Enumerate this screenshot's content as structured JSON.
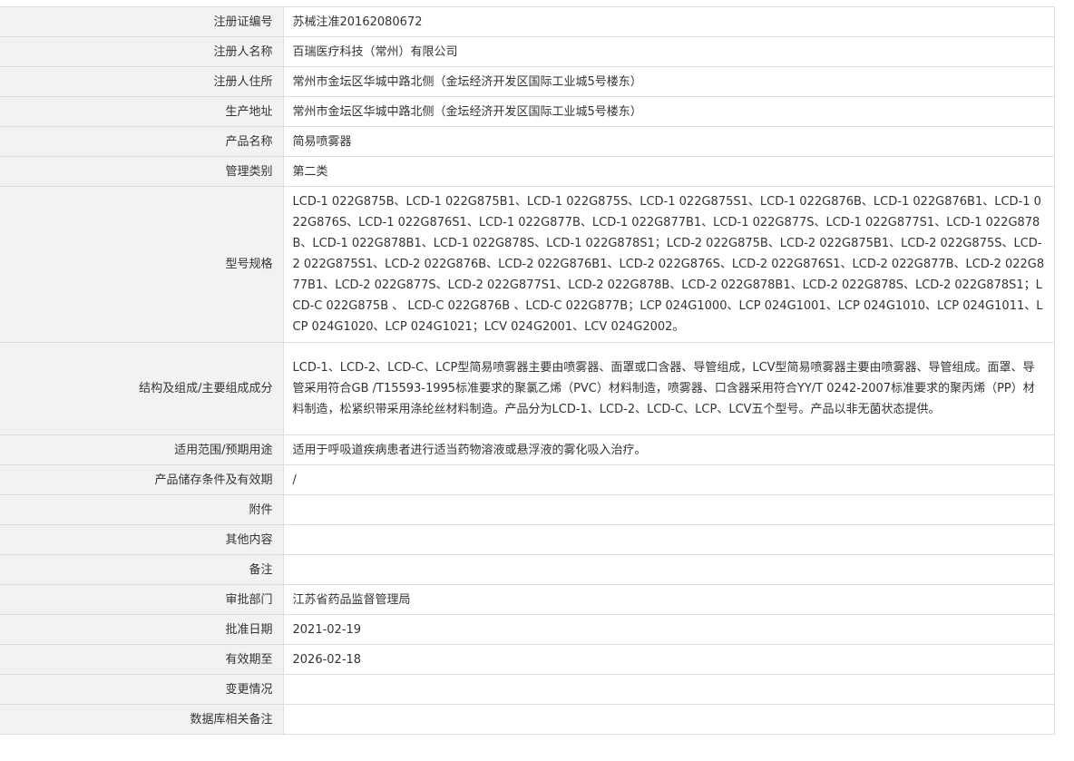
{
  "rows": [
    {
      "label": "注册证编号",
      "value": "苏械注准20162080672"
    },
    {
      "label": "注册人名称",
      "value": "百瑞医疗科技（常州）有限公司"
    },
    {
      "label": "注册人住所",
      "value": "常州市金坛区华城中路北侧（金坛经济开发区国际工业城5号楼东）"
    },
    {
      "label": "生产地址",
      "value": "常州市金坛区华城中路北侧（金坛经济开发区国际工业城5号楼东）"
    },
    {
      "label": "产品名称",
      "value": "简易喷雾器"
    },
    {
      "label": "管理类别",
      "value": "第二类"
    },
    {
      "label": "型号规格",
      "value": "LCD-1 022G875B、LCD-1 022G875B1、LCD-1 022G875S、LCD-1 022G875S1、LCD-1 022G876B、LCD-1 022G876B1、LCD-1 022G876S、LCD-1 022G876S1、LCD-1 022G877B、LCD-1 022G877B1、LCD-1 022G877S、LCD-1 022G877S1、LCD-1 022G878B、LCD-1 022G878B1、LCD-1 022G878S、LCD-1 022G878S1；LCD-2 022G875B、LCD-2 022G875B1、LCD-2 022G875S、LCD-2 022G875S1、LCD-2 022G876B、LCD-2 022G876B1、LCD-2 022G876S、LCD-2 022G876S1、LCD-2 022G877B、LCD-2 022G877B1、LCD-2 022G877S、LCD-2 022G877S1、LCD-2 022G878B、LCD-2 022G878B1、LCD-2 022G878S、LCD-2 022G878S1；LCD-C 022G875B 、 LCD-C 022G876B 、LCD-C 022G877B；LCP 024G1000、LCP 024G1001、LCP 024G1010、LCP 024G1011、LCP 024G1020、LCP 024G1021；LCV 024G2001、LCV 024G2002。"
    },
    {
      "label": "结构及组成/主要组成成分",
      "value": "LCD-1、LCD-2、LCD-C、LCP型简易喷雾器主要由喷雾器、面罩或口含器、导管组成，LCV型简易喷雾器主要由喷雾器、导管组成。面罩、导管采用符合GB /T15593-1995标准要求的聚氯乙烯（PVC）材料制造，喷雾器、口含器采用符合YY/T 0242-2007标准要求的聚丙烯（PP）材料制造，松紧织带采用涤纶丝材料制造。产品分为LCD-1、LCD-2、LCD-C、LCP、LCV五个型号。产品以非无菌状态提供。"
    },
    {
      "label": "适用范围/预期用途",
      "value": "适用于呼吸道疾病患者进行适当药物溶液或悬浮液的雾化吸入治疗。"
    },
    {
      "label": "产品储存条件及有效期",
      "value": "/"
    },
    {
      "label": "附件",
      "value": ""
    },
    {
      "label": "其他内容",
      "value": ""
    },
    {
      "label": "备注",
      "value": ""
    },
    {
      "label": "审批部门",
      "value": "江苏省药品监督管理局"
    },
    {
      "label": "批准日期",
      "value": "2021-02-19"
    },
    {
      "label": "有效期至",
      "value": "2026-02-18"
    },
    {
      "label": "变更情况",
      "value": ""
    },
    {
      "label": "数据库相关备注",
      "value": ""
    }
  ]
}
